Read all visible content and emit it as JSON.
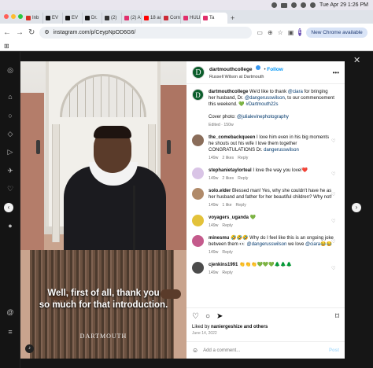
{
  "menubar": {
    "datetime": "Tue Apr 29  1:26 PM"
  },
  "tabs": [
    {
      "label": "Inb",
      "color": "#d93025"
    },
    {
      "label": "EV",
      "color": "#111111"
    },
    {
      "label": "EV",
      "color": "#111111"
    },
    {
      "label": "Dr.",
      "color": "#111111"
    },
    {
      "label": "(2)",
      "color": "#333333"
    },
    {
      "label": "(2) AP",
      "color": "#e1306c"
    },
    {
      "label": "18 acc",
      "color": "#ff0000"
    },
    {
      "label": "Corne",
      "color": "#cc2a36"
    },
    {
      "label": "HULR",
      "color": "#e1306c"
    },
    {
      "label": "Ta",
      "color": "#e1306c",
      "active": true
    }
  ],
  "toolbar": {
    "url": "instagram.com/p/CeypNpOD6G6/",
    "profile_initial": "E",
    "chrome_pill": "New Chrome available"
  },
  "post": {
    "username": "dartmouthcollege",
    "follow": "Follow",
    "location": "Russell Wilson at Dartmouth",
    "caption_lines": [
      "Well, first of all, thank you",
      "so much for that introduction."
    ],
    "wordmark": "DARTMOUTH",
    "liked_prefix": "Liked by ",
    "liked_user": "naniergeshize",
    "liked_suffix": " and others",
    "date": "June 14, 2022",
    "add_comment": "Add a comment...",
    "post_button": "Post"
  },
  "main_caption": {
    "username": "dartmouthcollege",
    "text_a": " We'd like to thank ",
    "mention_a": "@ciara",
    "text_b": " for bringing her husband, Dr. ",
    "mention_b": "@dangerusswilson",
    "text_c": ", to our commencement this weekend. 💚 ",
    "hashtag": "#Dartmouth22s",
    "photo_prefix": "Cover photo: ",
    "photo_credit": "@julialevinephotography",
    "meta": "Edited · 150w"
  },
  "comments": [
    {
      "user": "the_comebackqueen",
      "text": " I love him even in his big moments he shouts out his wife I love them together CONGRATULATIONS Dr. ",
      "mention": "dangerusswilson",
      "age": "149w",
      "likes": "2 likes",
      "reply": "Reply",
      "color": "#8a6d5a"
    },
    {
      "user": "stephanietaylorteal",
      "text": " I love the way you love!❤️",
      "mention": "",
      "age": "149w",
      "likes": "2 likes",
      "reply": "Reply",
      "color": "#d9c4e6"
    },
    {
      "user": "solo.elder",
      "text": " Blessed man! Yes, why she couldn't have he as her husband and father for her beautiful children? Why not!",
      "mention": "",
      "age": "149w",
      "likes": "1 like",
      "reply": "Reply",
      "color": "#b08a6a"
    },
    {
      "user": "voyagers_uganda",
      "text": " 💚",
      "mention": "",
      "age": "149w",
      "likes": "",
      "reply": "Reply",
      "color": "#e3c23a"
    },
    {
      "user": "minesmu",
      "text": " 🤣🤣🤣 Why do I feel like this is an ongoing joke between them 👀 ",
      "mention": "@dangerusswilson",
      "tail": " we love ",
      "mention2": "@ciara",
      "end": "😂😂",
      "age": "149w",
      "likes": "",
      "reply": "Reply",
      "color": "#c45a8c"
    },
    {
      "user": "cjenkins1991",
      "text": " 👏👏👏💚💚💚🌲🌲🌲",
      "mention": "",
      "age": "149w",
      "likes": "",
      "reply": "Reply",
      "color": "#4c4c4c"
    }
  ]
}
